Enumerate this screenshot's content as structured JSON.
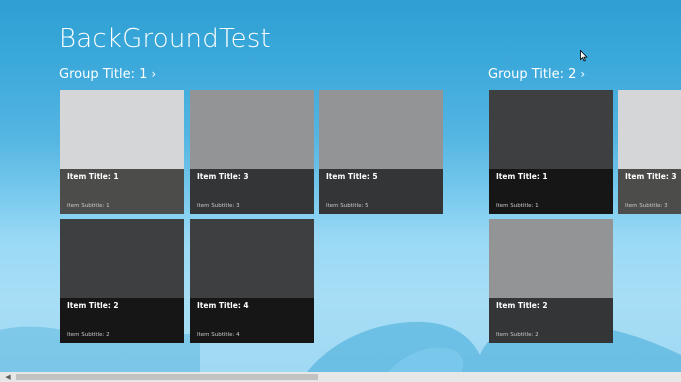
{
  "app": {
    "title": "BackGroundTest"
  },
  "groups": [
    {
      "header": "Group Title: 1",
      "items": [
        {
          "title": "Item Title: 1",
          "subtitle": "Item Subtitle: 1",
          "image_color": "#d5d6d7",
          "info_color": "#4c4d4b"
        },
        {
          "title": "Item Title: 3",
          "subtitle": "Item Subtitle: 3",
          "image_color": "#939495",
          "info_color": "#343536"
        },
        {
          "title": "Item Title: 5",
          "subtitle": "Item Subtitle: 5",
          "image_color": "#939495",
          "info_color": "#343536"
        },
        {
          "title": "Item Title: 2",
          "subtitle": "Item Subtitle: 2",
          "image_color": "#3e3f40",
          "info_color": "#161616"
        },
        {
          "title": "Item Title: 4",
          "subtitle": "Item Subtitle: 4",
          "image_color": "#3e3f40",
          "info_color": "#161616"
        }
      ]
    },
    {
      "header": "Group Title: 2",
      "items": [
        {
          "title": "Item Title: 1",
          "subtitle": "Item Subtitle: 1",
          "image_color": "#3e3f40",
          "info_color": "#161616"
        },
        {
          "title": "Item Title: 3",
          "subtitle": "Item Subtitle: 3",
          "image_color": "#d5d6d7",
          "info_color": "#4c4d4b"
        },
        {
          "title": "Item Title: 2",
          "subtitle": "Item Subtitle: 2",
          "image_color": "#939495",
          "info_color": "#343536"
        }
      ]
    }
  ],
  "icons": {
    "chevron": "chevron-right-icon",
    "scroll_left": "scroll-left-arrow-icon",
    "cursor": "mouse-pointer-icon"
  }
}
